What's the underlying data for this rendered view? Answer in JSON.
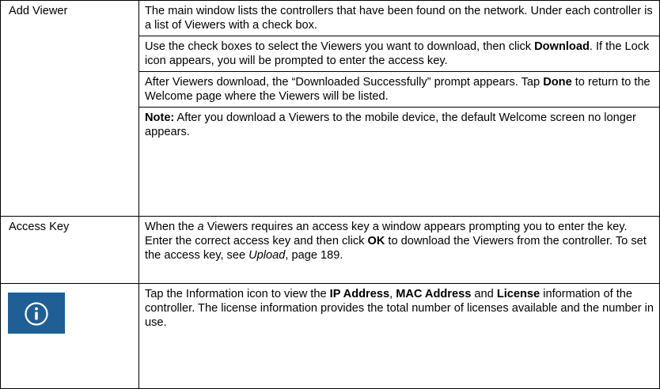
{
  "rows": [
    {
      "term": "Add Viewer",
      "paragraphs": [
        {
          "text": "The main window lists the controllers that have been found on the network. Under each controller is a list of Viewers with a check box."
        },
        {
          "part1": "Use the check boxes to select the Viewers you want to download, then click ",
          "bold1": "Download",
          "part2": ". If the Lock icon appears, you will be prompted to enter the access key."
        },
        {
          "part1": "After Viewers download, the “Downloaded Successfully” prompt appears. Tap ",
          "bold1": "Done",
          "part2": " to return to the Welcome page where the Viewers will be listed."
        },
        {
          "bold1": "Note:",
          "part1": " After you download a Viewers to the mobile device, the default Welcome screen no longer appears."
        }
      ]
    },
    {
      "term": "Access Key",
      "paragraphs": [
        {
          "part1": "When the ",
          "ital1": "a",
          "part2": " Viewers requires an access key a window appears prompting you to enter the key. Enter the correct access key and then click ",
          "bold1": "OK",
          "part3": " to download the Viewers from the controller. To set the access key, see ",
          "ital2": "Upload",
          "part4": ", page 189."
        }
      ]
    },
    {
      "icon": "information-icon",
      "icon_color": "#1f5f96",
      "paragraphs": [
        {
          "part1": "Tap the Information icon to view the ",
          "bold1": "IP Address",
          "part2": ", ",
          "bold2": "MAC Address",
          "part3": " and ",
          "bold3": "License",
          "part4": " information of the controller. The license information provides the total number of licenses available and the number in use."
        }
      ]
    }
  ]
}
